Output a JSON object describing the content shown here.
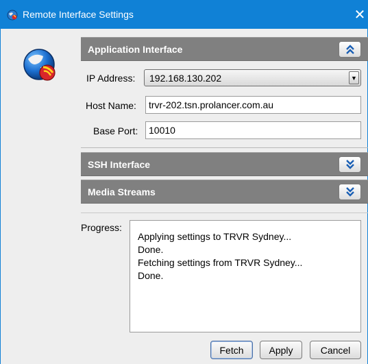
{
  "window": {
    "title": "Remote Interface Settings",
    "close_glyph": "✕",
    "app_icon": "globe-network-icon",
    "accent_color": "#1081d6"
  },
  "sections": {
    "application": {
      "label": "Application Interface",
      "state": "expanded",
      "toggle_icon": "collapse-chevrons-icon"
    },
    "ssh": {
      "label": "SSH Interface",
      "state": "collapsed",
      "toggle_icon": "expand-chevrons-icon"
    },
    "media": {
      "label": "Media Streams",
      "state": "collapsed",
      "toggle_icon": "expand-chevrons-icon"
    }
  },
  "fields": {
    "ip_address": {
      "label": "IP Address:",
      "value": "192.168.130.202"
    },
    "host_name": {
      "label": "Host Name:",
      "value": "trvr-202.tsn.prolancer.com.au"
    },
    "base_port": {
      "label": "Base Port:",
      "value": "10010"
    }
  },
  "progress": {
    "label": "Progress:",
    "lines": [
      "Applying settings to TRVR Sydney...",
      "Done.",
      "Fetching settings from TRVR Sydney...",
      "Done."
    ]
  },
  "buttons": {
    "fetch": "Fetch",
    "apply": "Apply",
    "cancel": "Cancel"
  }
}
